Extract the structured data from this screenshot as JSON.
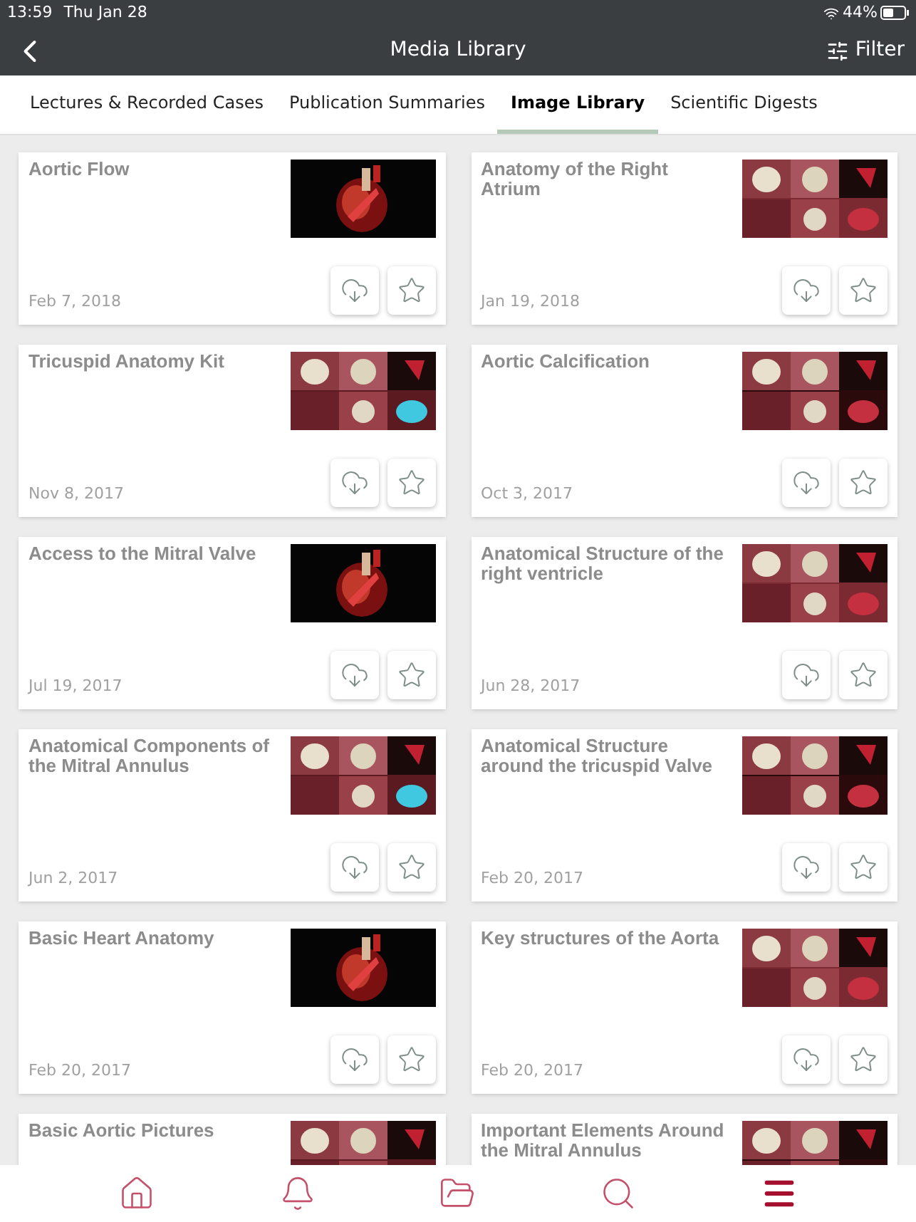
{
  "status_bar": {
    "time": "13:59",
    "date": "Thu Jan 28",
    "battery": "44%"
  },
  "nav": {
    "title": "Media Library",
    "filter": "Filter"
  },
  "tabs": [
    {
      "label": "Lectures & Recorded Cases",
      "selected": false
    },
    {
      "label": "Publication Summaries",
      "selected": false
    },
    {
      "label": "Image Library",
      "selected": true
    },
    {
      "label": "Scientific Digests",
      "selected": false
    }
  ],
  "items": [
    {
      "title": "Aortic Flow",
      "date": "Feb 7, 2018"
    },
    {
      "title": "Anatomy of the Right Atrium",
      "date": "Jan 19, 2018"
    },
    {
      "title": "Tricuspid Anatomy Kit",
      "date": "Nov 8, 2017"
    },
    {
      "title": "Aortic Calcification",
      "date": "Oct 3, 2017"
    },
    {
      "title": "Access to the Mitral Valve",
      "date": "Jul 19, 2017"
    },
    {
      "title": "Anatomical Structure of the right ventricle",
      "date": "Jun 28, 2017"
    },
    {
      "title": "Anatomical Components of the Mitral Annulus",
      "date": "Jun 2, 2017"
    },
    {
      "title": "Anatomical Structure around the tricuspid Valve",
      "date": "Feb 20, 2017"
    },
    {
      "title": "Basic Heart Anatomy",
      "date": "Feb 20, 2017"
    },
    {
      "title": "Key structures of the Aorta",
      "date": "Feb 20, 2017"
    },
    {
      "title": "Basic Aortic Pictures"
    },
    {
      "title": "Important Elements Around the Mitral Annulus"
    }
  ],
  "bottom_nav": [
    {
      "kind": "home",
      "selected": false
    },
    {
      "kind": "bell",
      "selected": false
    },
    {
      "kind": "folder",
      "selected": false
    },
    {
      "kind": "search",
      "selected": false
    },
    {
      "kind": "menu",
      "selected": true
    }
  ]
}
